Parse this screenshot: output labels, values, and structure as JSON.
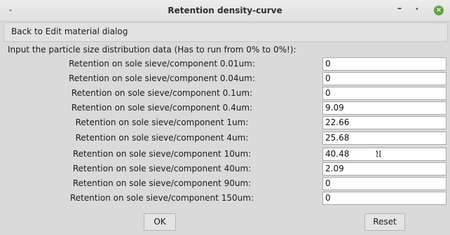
{
  "window": {
    "title": "Retention density-curve",
    "menu_icon": "chevron-down-icon",
    "minimize_icon": "minimize-icon",
    "maximize_icon": "maximize-icon",
    "close_icon": "close-icon",
    "close_color": "#5ea344"
  },
  "back_link": "Back to Edit material dialog",
  "instruction": "Input the particle size distribution data (Has to run from 0% to 0%!):",
  "rows": [
    {
      "label": "Retention on sole sieve/component 0.01um:",
      "value": "0"
    },
    {
      "label": "Retention on sole sieve/component 0.04um:",
      "value": "0"
    },
    {
      "label": "Retention on sole sieve/component 0.1um:",
      "value": "0"
    },
    {
      "label": "Retention on sole sieve/component 0.4um:",
      "value": "9.09"
    },
    {
      "label": "Retention on sole sieve/component 1um:",
      "value": "22.66"
    },
    {
      "label": "Retention on sole sieve/component 4um:",
      "value": "25.68"
    },
    {
      "label": "Retention on sole sieve/component 10um:",
      "value": "40.48"
    },
    {
      "label": "Retention on sole sieve/component 40um:",
      "value": "2.09"
    },
    {
      "label": "Retention on sole sieve/component 90um:",
      "value": "0"
    },
    {
      "label": "Retention on sole sieve/component 150um:",
      "value": "0"
    }
  ],
  "buttons": {
    "ok": "OK",
    "reset": "Reset"
  }
}
